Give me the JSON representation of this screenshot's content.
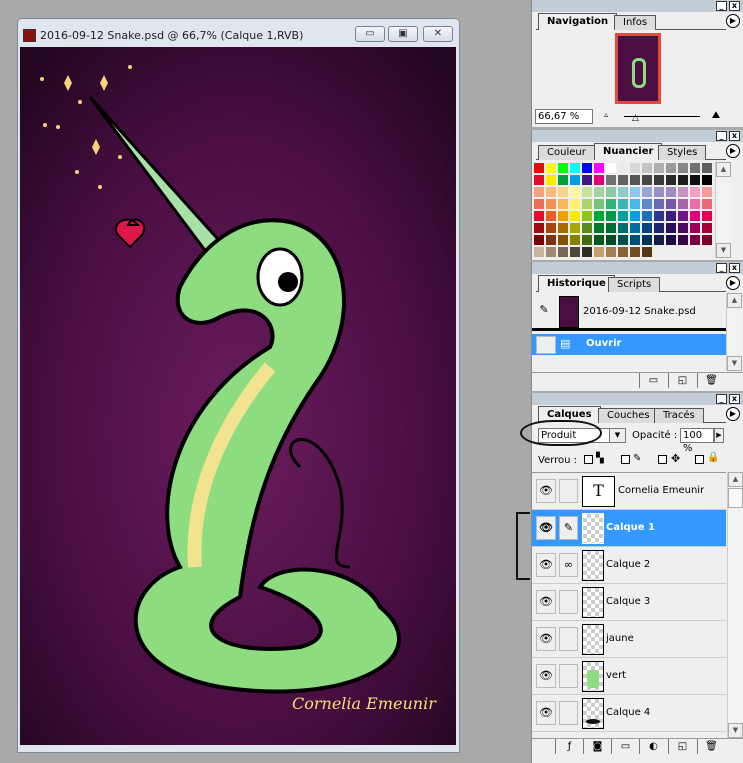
{
  "document": {
    "title": "2016-09-12 Snake.psd @ 66,7% (Calque 1,RVB)",
    "signature": "Cornelia Emeunir",
    "window_buttons": {
      "minimize": "▭",
      "maximize": "▣",
      "close": "✕"
    }
  },
  "navigation": {
    "tabs": [
      "Navigation",
      "Infos"
    ],
    "zoom": "66,67 %"
  },
  "swatches": {
    "tabs": [
      "Couleur",
      "Nuancier",
      "Styles"
    ],
    "colors": [
      [
        "#ff0000",
        "#ffff00",
        "#00ff00",
        "#00ffff",
        "#0000ff",
        "#ff00ff",
        "#ffffff",
        "#ebebeb",
        "#d7d7d7",
        "#c3c3c3",
        "#afafaf",
        "#9b9b9b",
        "#878787",
        "#737373",
        "#5f5f5f"
      ],
      [
        "#e30a2c",
        "#f5ec00",
        "#00a13a",
        "#00a0e4",
        "#3d1a80",
        "#e1007a",
        "#717171",
        "#636363",
        "#555555",
        "#474747",
        "#393939",
        "#2b2b2b",
        "#1d1d1d",
        "#0f0f0f",
        "#000000"
      ],
      [
        "#f4a37f",
        "#f7b97f",
        "#fbd48a",
        "#fef59c",
        "#c8e19e",
        "#a4d3a0",
        "#88cba4",
        "#8ccdcc",
        "#8cc8ee",
        "#93a8d6",
        "#978fc6",
        "#a28ac2",
        "#c892c0",
        "#f3a0c2",
        "#f49c9c"
      ],
      [
        "#ec7051",
        "#f29354",
        "#f7b858",
        "#fdf06a",
        "#acd46b",
        "#79c37a",
        "#2fb57a",
        "#3bb6b2",
        "#44b8e8",
        "#5e8acb",
        "#6a6bb3",
        "#7658a5",
        "#a966a6",
        "#ea6ea4",
        "#eb6a74"
      ],
      [
        "#e30a2c",
        "#e95e22",
        "#f29d00",
        "#fbeb00",
        "#8dc21f",
        "#00a63c",
        "#009a4a",
        "#00a29a",
        "#00a0e4",
        "#1f6eb5",
        "#2f3592",
        "#3b1c82",
        "#6c1685",
        "#e0007a",
        "#e3004f"
      ],
      [
        "#a00b0e",
        "#a54611",
        "#a86b00",
        "#aaa500",
        "#5a8b1d",
        "#007a2c",
        "#006a34",
        "#006f6b",
        "#006c9c",
        "#00447e",
        "#1d2567",
        "#280f5b",
        "#4c085e",
        "#9c0056",
        "#a00035"
      ],
      [
        "#7b0009",
        "#803208",
        "#825200",
        "#848000",
        "#416c13",
        "#005a1d",
        "#004d24",
        "#00514e",
        "#004f73",
        "#00315c",
        "#141b4d",
        "#1d0944",
        "#380546",
        "#780040",
        "#7a0026"
      ],
      [
        "#c8b49a",
        "#9f8b73",
        "#756655",
        "#4f463c",
        "#2f2b27",
        "#c5a06e",
        "#a37e50",
        "#886134",
        "#6f4b22",
        "#583713"
      ]
    ]
  },
  "history": {
    "tabs": [
      "Historique",
      "Scripts"
    ],
    "snapshot": "2016-09-12 Snake.psd",
    "items": [
      {
        "label": "Ouvrir",
        "selected": true
      }
    ]
  },
  "layers": {
    "tabs": [
      "Calques",
      "Couches",
      "Tracés"
    ],
    "blend_mode": "Produit",
    "opacity_label": "Opacité :",
    "opacity": "100 %",
    "lock_label": "Verrou :",
    "items": [
      {
        "name": "Cornelia Emeunir",
        "type": "text",
        "selected": false
      },
      {
        "name": "Calque  1",
        "selected": true
      },
      {
        "name": "Calque  2",
        "linked": true,
        "selected": false
      },
      {
        "name": "Calque  3",
        "selected": false
      },
      {
        "name": "jaune",
        "selected": false
      },
      {
        "name": "vert",
        "selected": false
      },
      {
        "name": "Calque  4",
        "selected": false
      }
    ]
  }
}
